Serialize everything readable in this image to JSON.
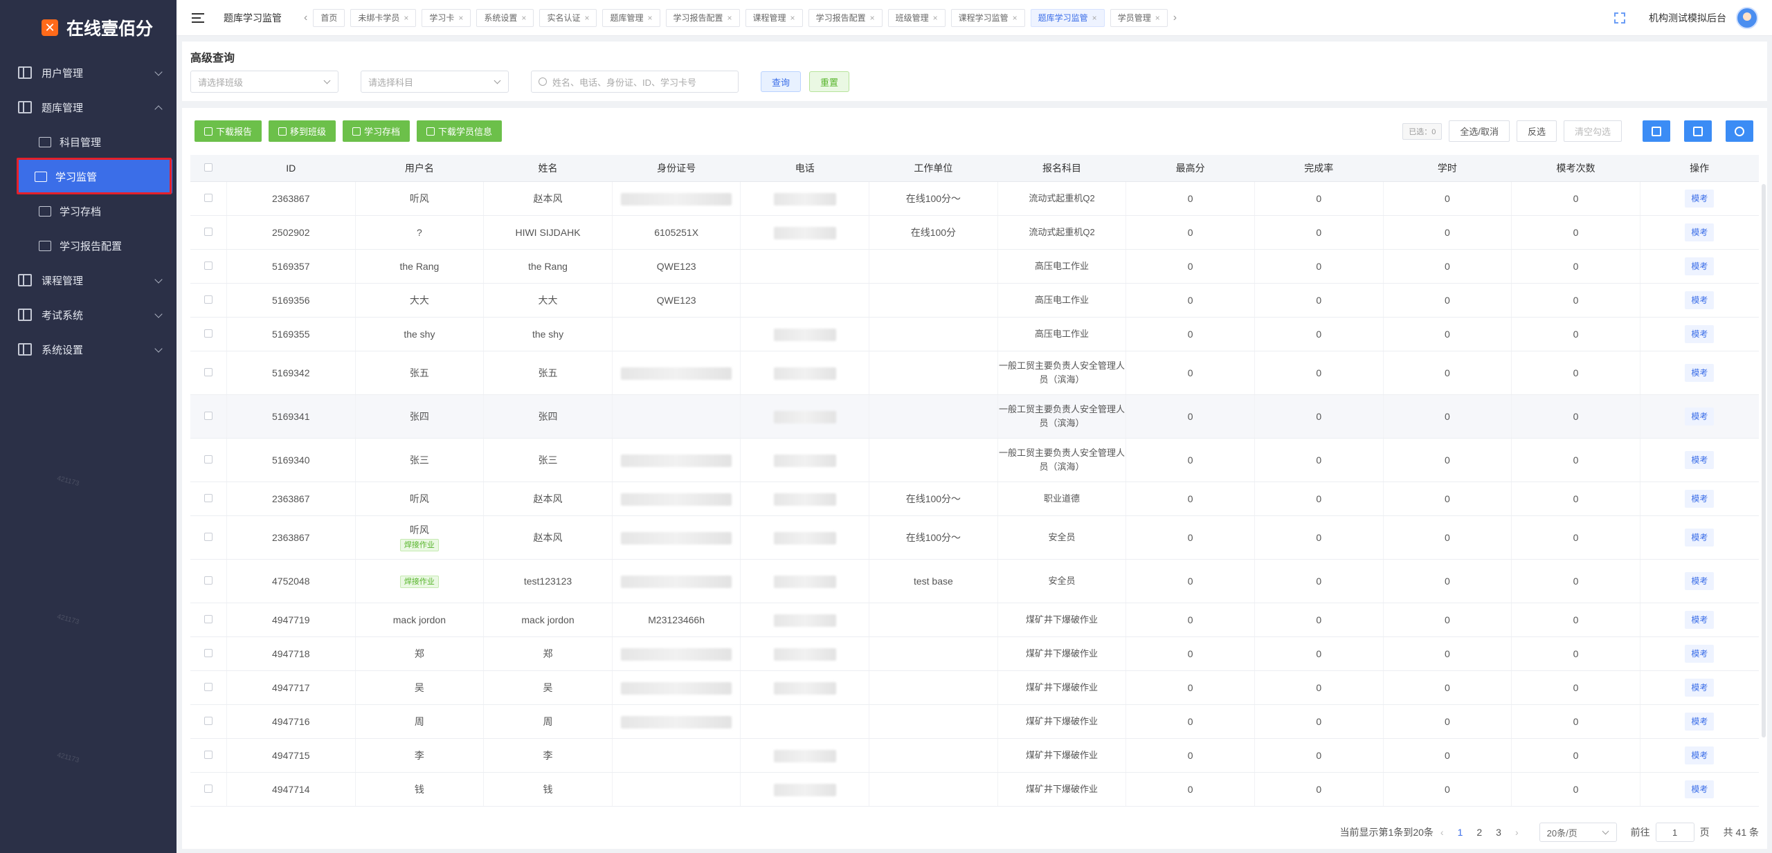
{
  "brand": {
    "name": "在线壹佰分",
    "logo_glyph": "✕"
  },
  "sidebar": {
    "items": [
      {
        "label": "用户管理",
        "expanded": false
      },
      {
        "label": "题库管理",
        "expanded": true
      }
    ],
    "sub_items": [
      {
        "label": "科目管理"
      },
      {
        "label": "学习监管"
      },
      {
        "label": "学习存档"
      },
      {
        "label": "学习报告配置"
      }
    ],
    "items_after": [
      {
        "label": "课程管理"
      },
      {
        "label": "考试系统"
      },
      {
        "label": "系统设置"
      }
    ],
    "watermark": "421173"
  },
  "topbar": {
    "breadcrumb": "题库学习监管",
    "tabs": [
      {
        "label": "首页",
        "closable": false
      },
      {
        "label": "未绑卡学员",
        "closable": true
      },
      {
        "label": "学习卡",
        "closable": true
      },
      {
        "label": "系统设置",
        "closable": true
      },
      {
        "label": "实名认证",
        "closable": true
      },
      {
        "label": "题库管理",
        "closable": true
      },
      {
        "label": "学习报告配置",
        "closable": true
      },
      {
        "label": "课程管理",
        "closable": true
      },
      {
        "label": "学习报告配置",
        "closable": true
      },
      {
        "label": "班级管理",
        "closable": true
      },
      {
        "label": "课程学习监管",
        "closable": true
      },
      {
        "label": "题库学习监管",
        "closable": true,
        "active": true
      },
      {
        "label": "学员管理",
        "closable": true
      }
    ],
    "prev_arrow": "‹",
    "next_arrow": "›",
    "close_glyph": "×",
    "account_name": "机构测试模拟后台"
  },
  "search": {
    "title": "高级查询",
    "class_placeholder": "请选择班级",
    "subject_placeholder": "请选择科目",
    "keyword_placeholder": "姓名、电话、身份证、ID、学习卡号",
    "query_label": "查询",
    "reset_label": "重置"
  },
  "toolbar": {
    "download_report": "下载报告",
    "move_class": "移到班级",
    "archive": "学习存档",
    "download_info": "下载学员信息",
    "selected_count": "已选：0",
    "select_all": "全选/取消",
    "invert": "反选",
    "clear": "清空勾选"
  },
  "table": {
    "columns": [
      "",
      "ID",
      "用户名",
      "姓名",
      "身份证号",
      "电话",
      "工作单位",
      "报名科目",
      "最高分",
      "完成率",
      "学时",
      "模考次数",
      "操作"
    ],
    "rows": [
      {
        "id": "2363867",
        "username": "听风",
        "tag": "",
        "name": "赵本风",
        "idcard": "",
        "idcard_blur": true,
        "phone_blur": true,
        "work": "在线100分～",
        "subject": "流动式起重机Q2",
        "top": "0",
        "rate": "0",
        "hours": "0",
        "mock": "0",
        "op": "模考"
      },
      {
        "id": "2502902",
        "username": "?",
        "tag": "",
        "name": "HIWI SIJDAHK",
        "idcard": "6105251X",
        "idcard_blur": false,
        "phone_blur": true,
        "work": "在线100分",
        "subject": "流动式起重机Q2",
        "top": "0",
        "rate": "0",
        "hours": "0",
        "mock": "0",
        "op": "模考"
      },
      {
        "id": "5169357",
        "username": "the Rang",
        "tag": "",
        "name": "the Rang",
        "idcard": "QWE123",
        "idcard_blur": false,
        "phone_blur": false,
        "work": "",
        "subject": "高压电工作业",
        "top": "0",
        "rate": "0",
        "hours": "0",
        "mock": "0",
        "op": "模考"
      },
      {
        "id": "5169356",
        "username": "大大",
        "tag": "",
        "name": "大大",
        "idcard": "QWE123",
        "idcard_blur": false,
        "phone_blur": false,
        "work": "",
        "subject": "高压电工作业",
        "top": "0",
        "rate": "0",
        "hours": "0",
        "mock": "0",
        "op": "模考"
      },
      {
        "id": "5169355",
        "username": "the shy",
        "tag": "",
        "name": "the shy",
        "idcard": "",
        "idcard_blur": false,
        "phone_blur": true,
        "work": "",
        "subject": "高压电工作业",
        "top": "0",
        "rate": "0",
        "hours": "0",
        "mock": "0",
        "op": "模考"
      },
      {
        "id": "5169342",
        "username": "张五",
        "tag": "",
        "name": "张五",
        "idcard": "",
        "idcard_blur": true,
        "phone_blur": true,
        "work": "",
        "subject": "一般工贸主要负责人安全管理人员（滨海）",
        "top": "0",
        "rate": "0",
        "hours": "0",
        "mock": "0",
        "op": "模考",
        "tall": true
      },
      {
        "id": "5169341",
        "username": "张四",
        "tag": "",
        "name": "张四",
        "idcard": "",
        "idcard_blur": false,
        "phone_blur": true,
        "work": "",
        "subject": "一般工贸主要负责人安全管理人员（滨海）",
        "top": "0",
        "rate": "0",
        "hours": "0",
        "mock": "0",
        "op": "模考",
        "tall": true,
        "highlight": true
      },
      {
        "id": "5169340",
        "username": "张三",
        "tag": "",
        "name": "张三",
        "idcard": "",
        "idcard_blur": true,
        "phone_blur": true,
        "work": "",
        "subject": "一般工贸主要负责人安全管理人员（滨海）",
        "top": "0",
        "rate": "0",
        "hours": "0",
        "mock": "0",
        "op": "模考",
        "tall": true
      },
      {
        "id": "2363867",
        "username": "听风",
        "tag": "",
        "name": "赵本风",
        "idcard": "",
        "idcard_blur": true,
        "phone_blur": true,
        "work": "在线100分～",
        "subject": "职业道德",
        "top": "0",
        "rate": "0",
        "hours": "0",
        "mock": "0",
        "op": "模考"
      },
      {
        "id": "2363867",
        "username": "听风",
        "tag": "焊接作业",
        "name": "赵本风",
        "idcard": "",
        "idcard_blur": true,
        "phone_blur": true,
        "work": "在线100分～",
        "subject": "安全员",
        "top": "0",
        "rate": "0",
        "hours": "0",
        "mock": "0",
        "op": "模考",
        "tall": true
      },
      {
        "id": "4752048",
        "username": "",
        "tag": "焊接作业",
        "name": "test123123",
        "idcard": "",
        "idcard_blur": true,
        "phone_blur": true,
        "work": "test base",
        "subject": "安全员",
        "top": "0",
        "rate": "0",
        "hours": "0",
        "mock": "0",
        "op": "模考",
        "tall": true
      },
      {
        "id": "4947719",
        "username": "mack jordon",
        "tag": "",
        "name": "mack jordon",
        "idcard": "M23123466h",
        "idcard_blur": false,
        "phone_blur": true,
        "work": "",
        "subject": "煤矿井下爆破作业",
        "top": "0",
        "rate": "0",
        "hours": "0",
        "mock": "0",
        "op": "模考"
      },
      {
        "id": "4947718",
        "username": "郑",
        "tag": "",
        "name": "郑",
        "idcard": "",
        "idcard_blur": true,
        "phone_blur": true,
        "work": "",
        "subject": "煤矿井下爆破作业",
        "top": "0",
        "rate": "0",
        "hours": "0",
        "mock": "0",
        "op": "模考"
      },
      {
        "id": "4947717",
        "username": "吴",
        "tag": "",
        "name": "吴",
        "idcard": "",
        "idcard_blur": true,
        "phone_blur": true,
        "work": "",
        "subject": "煤矿井下爆破作业",
        "top": "0",
        "rate": "0",
        "hours": "0",
        "mock": "0",
        "op": "模考"
      },
      {
        "id": "4947716",
        "username": "周",
        "tag": "",
        "name": "周",
        "idcard": "",
        "idcard_blur": true,
        "phone_blur": false,
        "work": "",
        "subject": "煤矿井下爆破作业",
        "top": "0",
        "rate": "0",
        "hours": "0",
        "mock": "0",
        "op": "模考"
      },
      {
        "id": "4947715",
        "username": "李",
        "tag": "",
        "name": "李",
        "idcard": "",
        "idcard_blur": false,
        "phone_blur": true,
        "work": "",
        "subject": "煤矿井下爆破作业",
        "top": "0",
        "rate": "0",
        "hours": "0",
        "mock": "0",
        "op": "模考"
      },
      {
        "id": "4947714",
        "username": "钱",
        "tag": "",
        "name": "钱",
        "idcard": "",
        "idcard_blur": false,
        "phone_blur": true,
        "work": "",
        "subject": "煤矿井下爆破作业",
        "top": "0",
        "rate": "0",
        "hours": "0",
        "mock": "0",
        "op": "模考"
      }
    ]
  },
  "pagination": {
    "summary": "当前显示第1条到20条",
    "prev": "‹",
    "pages": [
      "1",
      "2",
      "3"
    ],
    "current": "1",
    "next": "›",
    "page_size": "20条/页",
    "goto_label": "前往",
    "goto_value": "1",
    "page_unit": "页",
    "total": "共 41 条"
  },
  "colors": {
    "sidebar_bg": "#2b3047",
    "accent": "#3b6ee8",
    "green": "#6cc04a",
    "highlight_outline": "#e5202a"
  }
}
